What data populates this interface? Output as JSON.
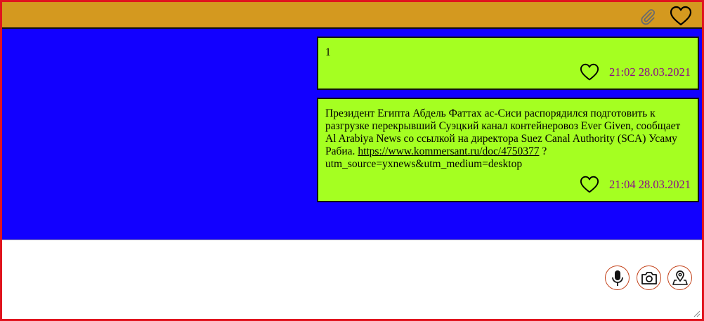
{
  "topbar": {
    "icons": [
      "paperclip-icon",
      "heart-icon"
    ],
    "color": "#d4991f"
  },
  "chat": {
    "background": "#1200ff",
    "bubble_color": "#a5ff21",
    "time_color": "#8a0a8a",
    "messages": [
      {
        "text": "1",
        "link": "",
        "after_link": "",
        "time": "21:02 28.03.2021"
      },
      {
        "text": "Президент Египта Абдель Фаттах ас-Сиси распорядился подготовить к разгрузке перекрывший Суэцкий канал контейнеровоз Ever Given, сообщает Al Arabiya News со ссылкой на директора Suez Canal Authority (SCA) Усаму Рабиа. ",
        "link": "https://www.kommersant.ru/doc/4750377",
        "after_link": " ?utm_source=yxnews&utm_medium=desktop",
        "time": "21:04 28.03.2021"
      }
    ]
  },
  "composer": {
    "value": "",
    "buttons": [
      "microphone-icon",
      "camera-icon",
      "location-pin-icon"
    ],
    "button_border_color": "#c4431b"
  },
  "frame_border_color": "#e0141e"
}
